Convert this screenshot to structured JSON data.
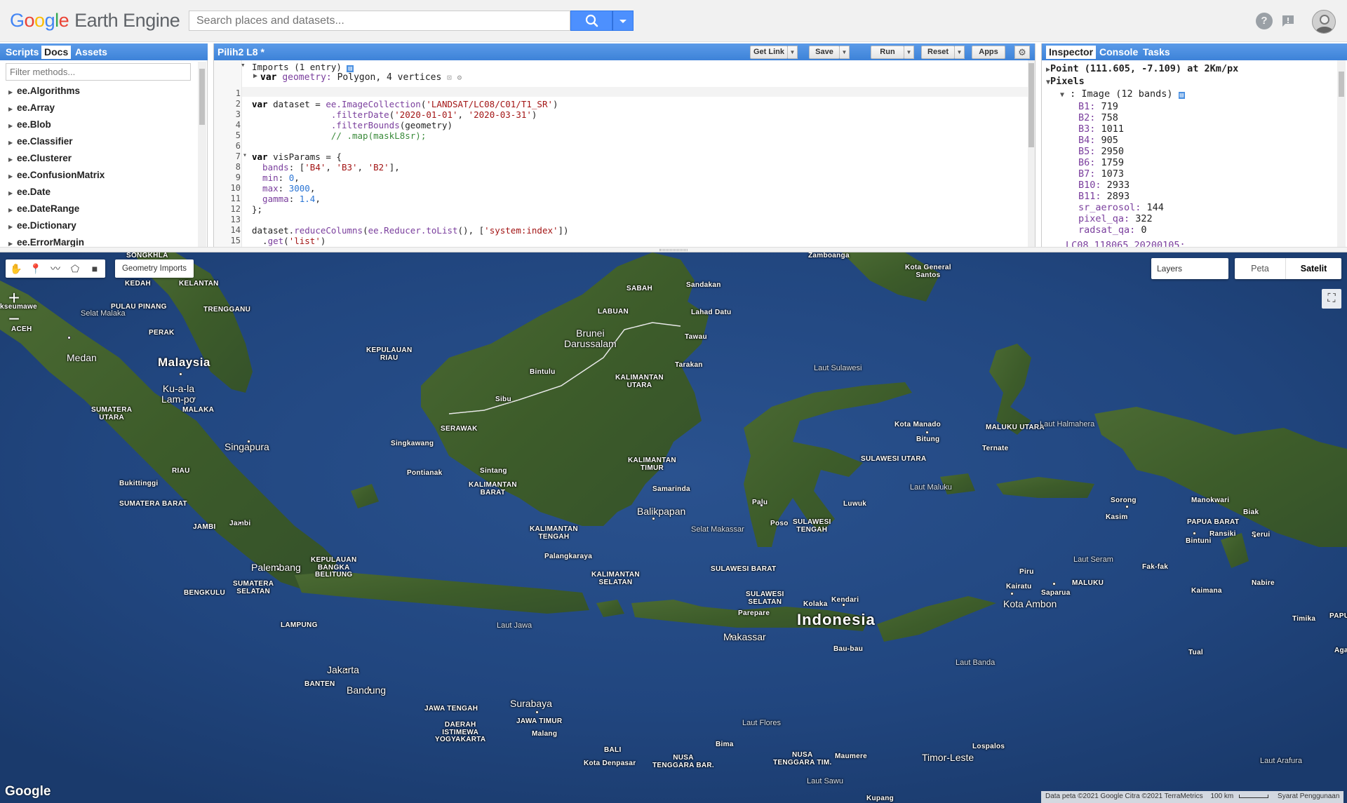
{
  "header": {
    "logo_parts": [
      "G",
      "o",
      "o",
      "g",
      "l",
      "e"
    ],
    "logo_product": "Earth Engine",
    "search_placeholder": "Search places and datasets...",
    "icons": {
      "search": "search-icon",
      "dropdown": "caret-down-icon",
      "help": "help-icon",
      "feedback": "feedback-icon"
    }
  },
  "left_panel": {
    "tabs": [
      "Scripts",
      "Docs",
      "Assets"
    ],
    "active_tab": "Docs",
    "filter_placeholder": "Filter methods...",
    "items": [
      "ee.Algorithms",
      "ee.Array",
      "ee.Blob",
      "ee.Classifier",
      "ee.Clusterer",
      "ee.ConfusionMatrix",
      "ee.Date",
      "ee.DateRange",
      "ee.Dictionary",
      "ee.ErrorMargin"
    ]
  },
  "editor": {
    "title": "Pilih2 L8 *",
    "buttons": {
      "get_link": "Get Link",
      "save": "Save",
      "run": "Run",
      "reset": "Reset",
      "apps": "Apps"
    },
    "imports_header": "Imports (1 entry)",
    "import_line": {
      "kw": "var",
      "name": "geometry:",
      "desc": "Polygon, 4 vertices"
    },
    "line_numbers": [
      "1",
      "2",
      "3",
      "4",
      "5",
      "6",
      "7",
      "8",
      "9",
      "10",
      "11",
      "12",
      "13",
      "14",
      "15"
    ]
  },
  "inspector": {
    "tabs": [
      "Inspector",
      "Console",
      "Tasks"
    ],
    "active_tab": "Inspector",
    "point": "Point (111.605, -7.109) at 2Km/px",
    "pixels_label": "Pixels",
    "image_label": ": Image (12 bands)",
    "bands": [
      {
        "k": "B1:",
        "v": "719"
      },
      {
        "k": "B2:",
        "v": "758"
      },
      {
        "k": "B3:",
        "v": "1011"
      },
      {
        "k": "B4:",
        "v": "905"
      },
      {
        "k": "B5:",
        "v": "2950"
      },
      {
        "k": "B6:",
        "v": "1759"
      },
      {
        "k": "B7:",
        "v": "1073"
      },
      {
        "k": "B10:",
        "v": "2933"
      },
      {
        "k": "B11:",
        "v": "2893"
      },
      {
        "k": "sr_aerosol:",
        "v": "144"
      },
      {
        "k": "pixel_qa:",
        "v": "322"
      },
      {
        "k": "radsat_qa:",
        "v": "0"
      }
    ],
    "next_item": "LC08_118065_20200105:"
  },
  "map": {
    "geometry_imports_label": "Geometry Imports",
    "layers_label": "Layers",
    "map_types": [
      "Peta",
      "Satelit"
    ],
    "active_map_type": "Satelit",
    "google_logo": "Google",
    "attribution": [
      "Data peta ©2021 Google Citra ©2021 TerraMetrics",
      "100 km",
      "Syarat Penggunaan"
    ],
    "labels": {
      "songkhla": "SONGKHLA",
      "kedah": "KEDAH",
      "kelantan": "KELANTAN",
      "pulau_pinang": "PULAU PINANG",
      "terengganu": "TRENGGANU",
      "perak": "PERAK",
      "seumawe": "kseumawe",
      "aceh": "ACEH",
      "medan": "Medan",
      "malaysia": "Malaysia",
      "kl": "Ku-a-la\nLam-pơ",
      "malaka": "MALAKA",
      "sumut": "SUMATERA\nUTARA",
      "singapura": "Singapura",
      "riau": "RIAU",
      "kep_riau": "KEPULAUAN\nRIAU",
      "bukittinggi": "Bukittinggi",
      "sumbar": "SUMATERA BARAT",
      "jambi_city": "Jambi",
      "jambi": "JAMBI",
      "palembang": "Palembang",
      "babel": "KEPULAUAN\nBANGKA\nBELITUNG",
      "bengkulu": "BENGKULU",
      "sumsel": "SUMATERA\nSELATAN",
      "lampung": "LAMPUNG",
      "selat_malaka": "Selat Malaka",
      "sabah": "SABAH",
      "sandakan": "Sandakan",
      "labuan": "LABUAN",
      "lahad_datu": "Lahad Datu",
      "brunei": "Brunei\nDarussalam",
      "tawau": "Tawau",
      "bintulu": "Bintulu",
      "kaltara": "KALIMANTAN\nUTARA",
      "tarakan": "Tarakan",
      "sibu": "Sibu",
      "serawak": "SERAWAK",
      "singkawang": "Singkawang",
      "pontianak": "Pontianak",
      "sintang": "Sintang",
      "kalbar": "KALIMANTAN\nBARAT",
      "kaltim": "KALIMANTAN\nTIMUR",
      "samarinda": "Samarinda",
      "balikpapan": "Balikpapan",
      "kalteng": "KALIMANTAN\nTENGAH",
      "palangkaraya": "Palangkaraya",
      "kalsel": "KALIMANTAN\nSELATAN",
      "laut_jawa": "Laut Jawa",
      "selat_makassar": "Selat Makassar",
      "kota_kinabalu": "Kota General\nSantos",
      "laut_sulawesi": "Laut Sulawesi",
      "manado": "Kota Manado",
      "bitung": "Bitung",
      "malut": "MALUKU UTARA",
      "ternate": "Ternate",
      "sulut": "SULAWESI UTARA",
      "laut_maluku": "Laut Maluku",
      "luwuk": "Luwuk",
      "palu": "Palu",
      "poso": "Poso",
      "sulteng": "SULAWESI\nTENGAH",
      "sulbar": "SULAWESI BARAT",
      "sulsel": "SULAWESI\nSELATAN",
      "parepare": "Parepare",
      "kolaka": "Kolaka",
      "kendari": "Kendari",
      "indonesia": "Indonesia",
      "makassar": "Makassar",
      "baubau": "Bau-bau",
      "laut_halmahera": "Laut Halmahera",
      "sorong": "Sorong",
      "manokwari": "Manokwari",
      "papua_barat": "PAPUA BARAT",
      "kasim": "Kasim",
      "bintuni": "Bintuni",
      "ransiki": "Ransiki",
      "biak": "Biak",
      "serui": "Serui",
      "laut_seram": "Laut Seram",
      "fakfak": "Fak-fak",
      "piru": "Piru",
      "kairatu": "Kairatu",
      "saparua": "Saparua",
      "maluku": "MALUKU",
      "kota_ambon": "Kota Ambon",
      "kaimana": "Kaimana",
      "nabire": "Nabire",
      "timika": "Timika",
      "papua": "PAPU",
      "tual": "Tual",
      "laut_banda": "Laut Banda",
      "jakarta": "Jakarta",
      "banten": "BANTEN",
      "bandung": "Bandung",
      "jateng": "JAWA TENGAH",
      "diy": "DAERAH\nISTIMEWA\nYOGYAKARTA",
      "surabaya": "Surabaya",
      "jatim": "JAWA TIMUR",
      "malang": "Malang",
      "bali": "BALI",
      "denpasar": "Kota Denpasar",
      "ntb": "NUSA\nTENGGARA BAR.",
      "bima": "Bima",
      "laut_flores": "Laut Flores",
      "ntt": "NUSA\nTENGGARA TIM.",
      "maumere": "Maumere",
      "lospalos": "Lospalos",
      "timor_leste": "Timor-Leste",
      "laut_sawu": "Laut Sawu",
      "laut_arafura": "Laut Arafura",
      "kupang": "Kupang",
      "zamboanga": "Zamboanga",
      "aga": "Aga"
    }
  },
  "colors": {
    "accent": "#4a90e2",
    "search_button": "#4d90fe",
    "ocean": "#23478a",
    "land": "#3f5e2c"
  }
}
